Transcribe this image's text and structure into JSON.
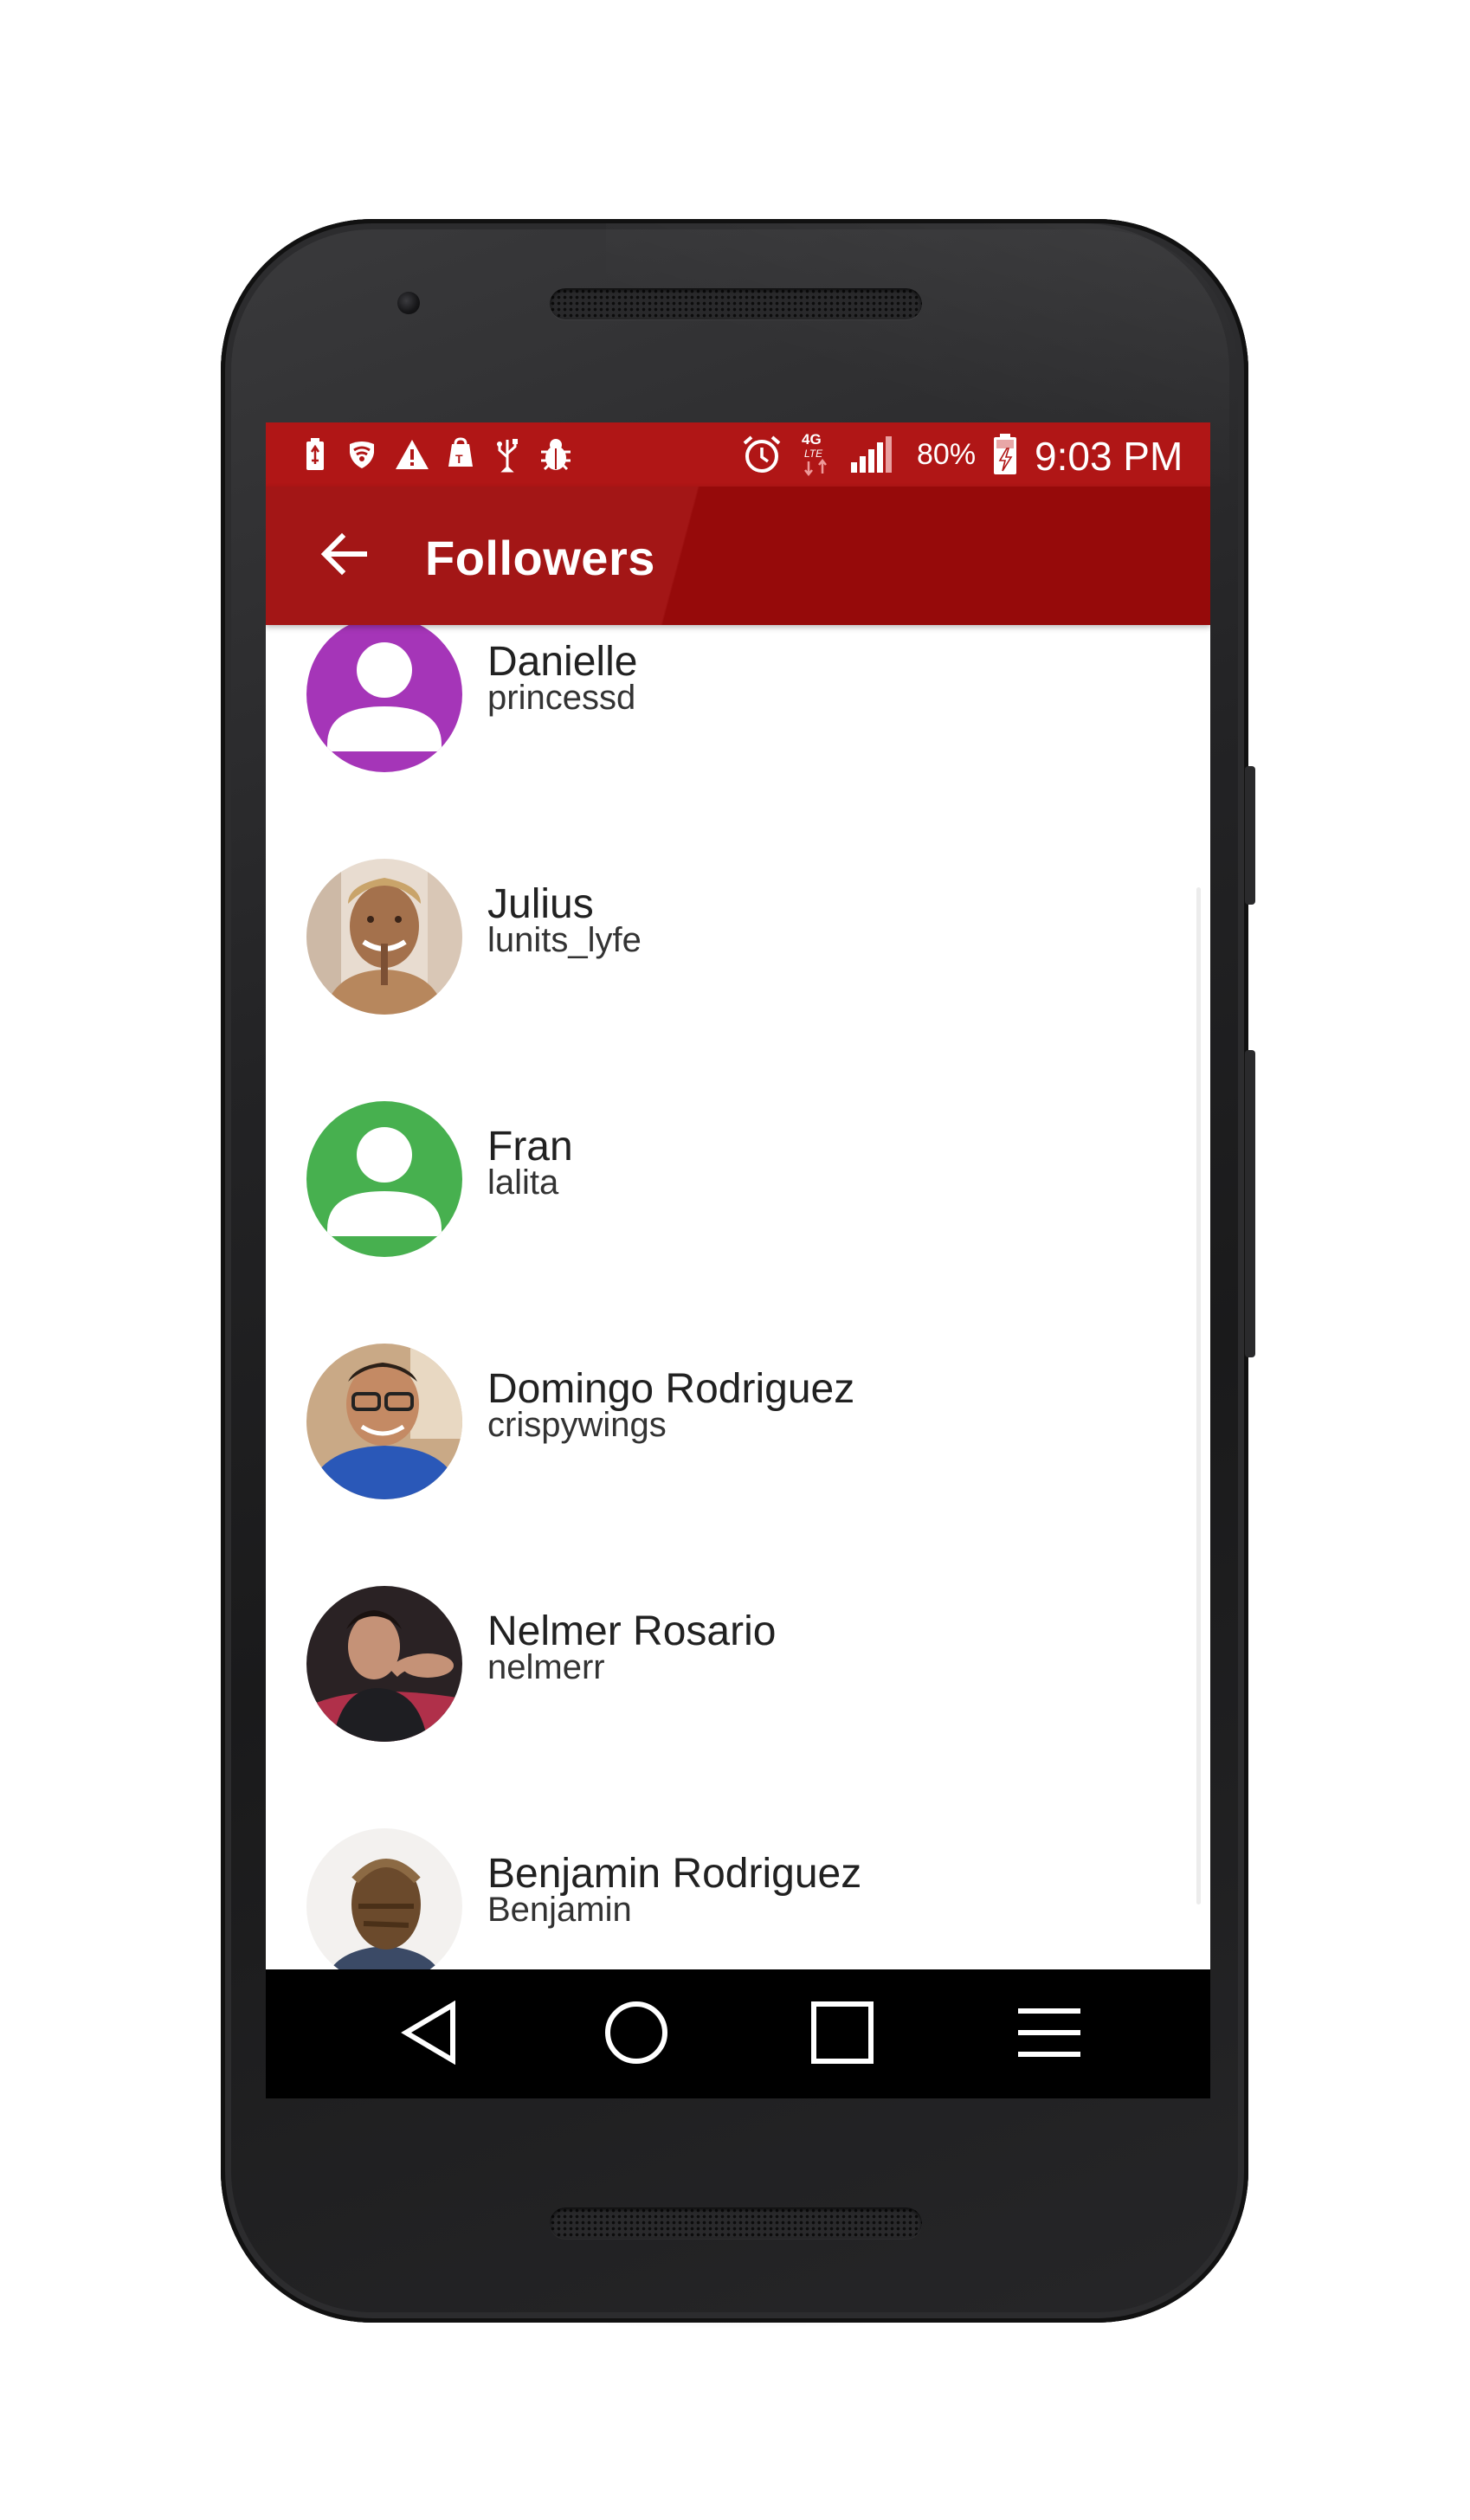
{
  "status_bar": {
    "icons": [
      "battery-saver-icon",
      "wifi-shield-icon",
      "warning-icon",
      "tmobile-app-icon",
      "usb-icon",
      "bug-icon",
      "alarm-icon",
      "4g-lte-icon",
      "signal-icon",
      "battery-charging-icon"
    ],
    "network": "4G LTE",
    "battery_percent": "80%",
    "time": "9:03 PM"
  },
  "toolbar": {
    "title": "Followers",
    "back_icon": "arrow-back-icon",
    "color": "#a31616"
  },
  "followers": [
    {
      "name": "Danielle",
      "username": "princessd",
      "avatar": "placeholder",
      "avatar_color": "#a535b8"
    },
    {
      "name": "Julius",
      "username": "lunits_lyfe",
      "avatar": "photo"
    },
    {
      "name": "Fran",
      "username": "lalita",
      "avatar": "placeholder",
      "avatar_color": "#47b04f"
    },
    {
      "name": "Domingo Rodriguez",
      "username": "crispywings",
      "avatar": "photo"
    },
    {
      "name": "Nelmer Rosario",
      "username": "nelmerr",
      "avatar": "photo"
    },
    {
      "name": "Benjamin Rodriguez",
      "username": "Benjamin",
      "avatar": "photo"
    }
  ],
  "nav_bar": {
    "buttons": [
      "back-triangle-icon",
      "home-circle-icon",
      "recents-square-icon",
      "menu-icon"
    ]
  }
}
